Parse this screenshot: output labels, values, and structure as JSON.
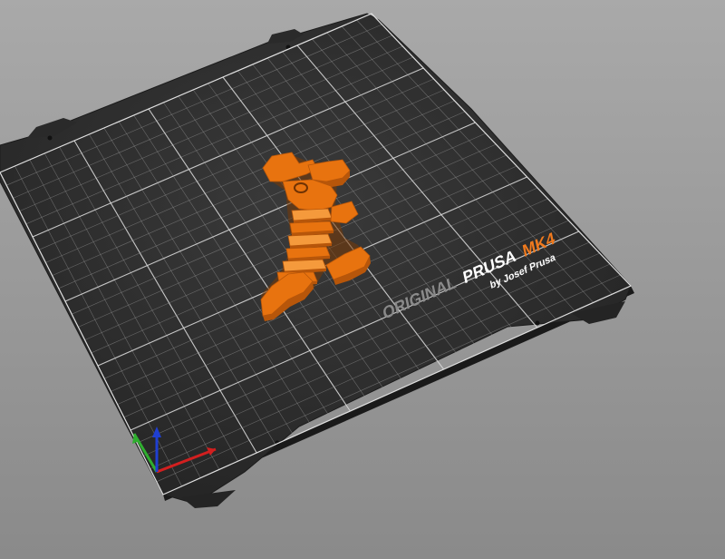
{
  "viewport": {
    "background_top": "#a9a9a9",
    "background_bottom": "#8a8a8a"
  },
  "bed": {
    "plate_color": "#2c2c2c",
    "grid_color": "#9a9a9a",
    "major_grid_color": "#d8d8d8",
    "branding": {
      "prefix": "ORIGINAL",
      "brand": "PRUSA",
      "model": "MK4",
      "byline": "by Josef Prusa",
      "prefix_color": "#8a8a8a",
      "brand_color": "#ffffff",
      "model_color": "#f07a1e",
      "byline_color": "#ffffff"
    }
  },
  "model": {
    "name": "flexi articulated figure",
    "color": "#e8730f",
    "shade_color": "#b7560a",
    "highlight_color": "#f59a3c"
  },
  "axes": {
    "x_color": "#d21f1f",
    "y_color": "#2fae2f",
    "z_color": "#1f3fd2"
  }
}
